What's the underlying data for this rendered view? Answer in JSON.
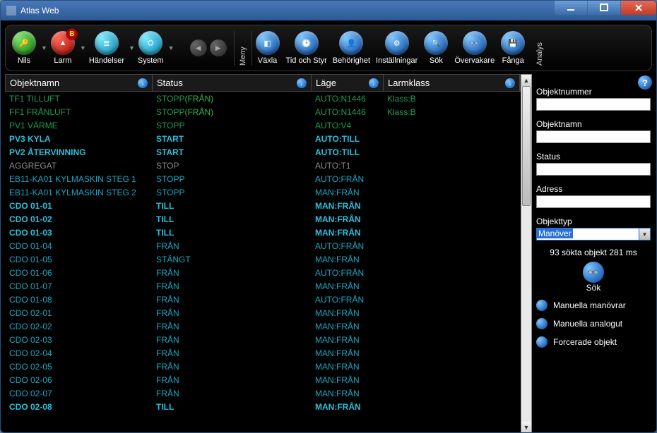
{
  "window_title": "Atlas Web",
  "toolbar": {
    "nils": "Nils",
    "larm": "Larm",
    "larm_badge": "B",
    "handelser": "Händelser",
    "system": "System",
    "meny": "Meny",
    "vaxla": "Växla",
    "tidstyr": "Tid och Styr",
    "behorighet": "Behörighet",
    "installningar": "Inställningar",
    "sok": "Sök",
    "overvakare": "Övervakare",
    "fanga": "Fånga",
    "analys": "Analys"
  },
  "grid": {
    "headers": {
      "obj": "Objektnamn",
      "status": "Status",
      "lage": "Läge",
      "larm": "Larmklass"
    },
    "rows": [
      {
        "obj": "TF1 TILLUFT",
        "status": "STOPP",
        "status_extra": "(FRÅN)",
        "lage": "AUTO:N1446",
        "larm": "Klass:B",
        "style": "g"
      },
      {
        "obj": "FF1 FRÅNLUFT",
        "status": "STOPP",
        "status_extra": "(FRÅN)",
        "lage": "AUTO:N1446",
        "larm": "Klass:B",
        "style": "g"
      },
      {
        "obj": "PV1 VÄRME",
        "status": "STOPP",
        "status_extra": "",
        "lage": "AUTO:V4",
        "larm": "",
        "style": "g"
      },
      {
        "obj": "PV3 KYLA",
        "status": "START",
        "status_extra": "",
        "lage": "AUTO:TILL",
        "larm": "",
        "style": "cb"
      },
      {
        "obj": "PV2 ÅTERVINNING",
        "status": "START",
        "status_extra": "",
        "lage": "AUTO:TILL",
        "larm": "",
        "style": "cb"
      },
      {
        "obj": "AGGREGAT",
        "status": "STOP",
        "status_extra": "",
        "lage": "AUTO:T1",
        "larm": "",
        "style": "gr"
      },
      {
        "obj": "EB11-KA01 KYLMASKIN STEG 1",
        "status": "STOPP",
        "status_extra": "",
        "lage": "AUTO:FRÅN",
        "larm": "",
        "style": "c"
      },
      {
        "obj": "EB11-KA01 KYLMASKIN STEG 2",
        "status": "STOPP",
        "status_extra": "",
        "lage": "MAN:FRÅN",
        "larm": "",
        "style": "c"
      },
      {
        "obj": "CDO 01-01",
        "status": "TILL",
        "status_extra": "",
        "lage": "MAN:FRÅN",
        "larm": "",
        "style": "cb"
      },
      {
        "obj": "CDO 01-02",
        "status": "TILL",
        "status_extra": "",
        "lage": "MAN:FRÅN",
        "larm": "",
        "style": "cb"
      },
      {
        "obj": "CDO 01-03",
        "status": "TILL",
        "status_extra": "",
        "lage": "MAN:FRÅN",
        "larm": "",
        "style": "cb"
      },
      {
        "obj": "CDO 01-04",
        "status": "FRÅN",
        "status_extra": "",
        "lage": "AUTO:FRÅN",
        "larm": "",
        "style": "c"
      },
      {
        "obj": "CDO 01-05",
        "status": "STÄNGT",
        "status_extra": "",
        "lage": "MAN:FRÅN",
        "larm": "",
        "style": "c"
      },
      {
        "obj": "CDO 01-06",
        "status": "FRÅN",
        "status_extra": "",
        "lage": "AUTO:FRÅN",
        "larm": "",
        "style": "c"
      },
      {
        "obj": "CDO 01-07",
        "status": "FRÅN",
        "status_extra": "",
        "lage": "MAN:FRÅN",
        "larm": "",
        "style": "c"
      },
      {
        "obj": "CDO 01-08",
        "status": "FRÅN",
        "status_extra": "",
        "lage": "AUTO:FRÅN",
        "larm": "",
        "style": "c"
      },
      {
        "obj": "CDO 02-01",
        "status": "FRÅN",
        "status_extra": "",
        "lage": "MAN:FRÅN",
        "larm": "",
        "style": "c"
      },
      {
        "obj": "CDO 02-02",
        "status": "FRÅN",
        "status_extra": "",
        "lage": "MAN:FRÅN",
        "larm": "",
        "style": "c"
      },
      {
        "obj": "CDO 02-03",
        "status": "FRÅN",
        "status_extra": "",
        "lage": "MAN:FRÅN",
        "larm": "",
        "style": "c"
      },
      {
        "obj": "CDO 02-04",
        "status": "FRÅN",
        "status_extra": "",
        "lage": "MAN:FRÅN",
        "larm": "",
        "style": "c"
      },
      {
        "obj": "CDO 02-05",
        "status": "FRÅN",
        "status_extra": "",
        "lage": "MAN:FRÅN",
        "larm": "",
        "style": "c"
      },
      {
        "obj": "CDO 02-06",
        "status": "FRÅN",
        "status_extra": "",
        "lage": "MAN:FRÅN",
        "larm": "",
        "style": "c"
      },
      {
        "obj": "CDO 02-07",
        "status": "FRÅN",
        "status_extra": "",
        "lage": "MAN:FRÅN",
        "larm": "",
        "style": "c"
      },
      {
        "obj": "CDO 02-08",
        "status": "TILL",
        "status_extra": "",
        "lage": "MAN:FRÅN",
        "larm": "",
        "style": "cb"
      }
    ]
  },
  "side": {
    "labels": {
      "objektnummer": "Objektnummer",
      "objektnamn": "Objektnamn",
      "status": "Status",
      "adress": "Adress",
      "objekttyp": "Objekttyp"
    },
    "values": {
      "objektnummer": "",
      "objektnamn": "",
      "status": "",
      "adress": "",
      "objekttyp": "Manöver"
    },
    "result_text": "93 sökta objekt 281 ms",
    "sok_label": "Sök",
    "checks": {
      "manuella_manovrar": "Manuella manövrar",
      "manuella_analogut": "Manuella analogut",
      "forcerade_objekt": "Forcerade objekt"
    }
  }
}
